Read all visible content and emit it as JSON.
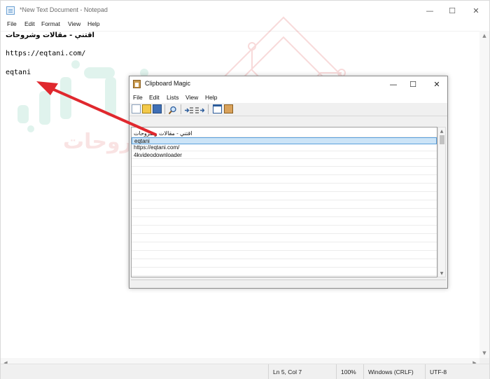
{
  "notepad": {
    "title": "*New Text Document - Notepad",
    "menu": [
      "File",
      "Edit",
      "Format",
      "View",
      "Help"
    ],
    "lines": [
      {
        "text": "اقتني - مقالات وشروحات",
        "rtl": true
      },
      {
        "text": ""
      },
      {
        "text": "https://eqtani.com/"
      },
      {
        "text": ""
      },
      {
        "text": "eqtani"
      }
    ],
    "status": {
      "position": "Ln 5, Col 7",
      "zoom": "100%",
      "line_endings": "Windows (CRLF)",
      "encoding": "UTF-8"
    },
    "controls": {
      "minimize": "—",
      "maximize": "☐",
      "close": "✕"
    }
  },
  "clipboard_magic": {
    "title": "Clipboard Magic",
    "menu": [
      "File",
      "Edit",
      "Lists",
      "View",
      "Help"
    ],
    "toolbar_icons": [
      "new-icon",
      "open-folder-icon",
      "save-icon",
      "find-icon",
      "indent-icon",
      "outdent-icon",
      "window-icon",
      "clipboard-icon"
    ],
    "items": [
      {
        "text": "اقتني - مقالات وشروحات",
        "selected": false
      },
      {
        "text": "eqtani",
        "selected": true
      },
      {
        "text": "https://eqtani.com/",
        "selected": false
      },
      {
        "text": "4kvideodownloader",
        "selected": false
      }
    ],
    "controls": {
      "minimize": "—",
      "maximize": "☐",
      "close": "✕"
    }
  },
  "colors": {
    "arrow": "#e0282e",
    "selection_bg": "#cce4f7",
    "selection_border": "#5aa0dd",
    "watermark_green": "#1aa67a",
    "watermark_red": "#e05a5a"
  }
}
